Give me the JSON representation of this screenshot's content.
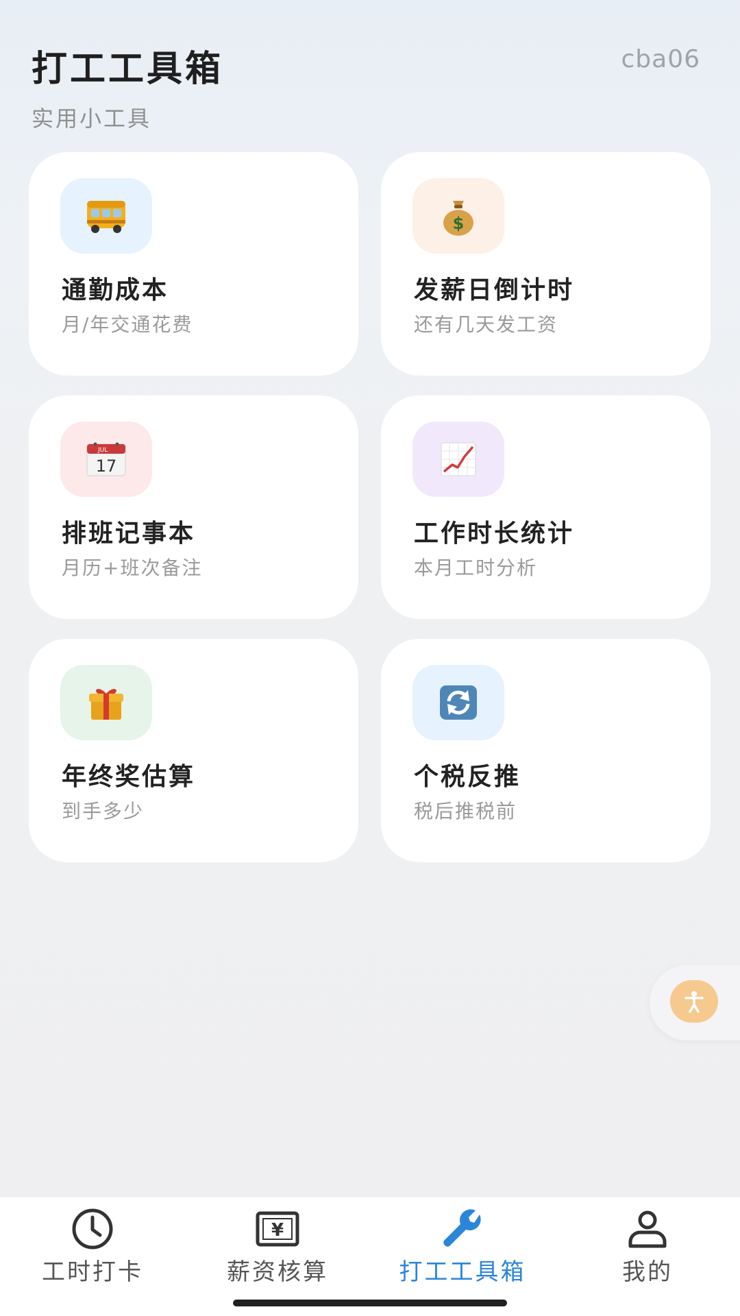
{
  "header": {
    "title": "打工工具箱",
    "subtitle": "实用小工具",
    "user_id": "cba06"
  },
  "tools": [
    {
      "name": "通勤成本",
      "desc": "月/年交通花费",
      "icon": "bus-icon",
      "icon_bg": "#e6f2fd"
    },
    {
      "name": "发薪日倒计时",
      "desc": "还有几天发工资",
      "icon": "money-bag-icon",
      "icon_bg": "#fdf0e6"
    },
    {
      "name": "排班记事本",
      "desc": "月历+班次备注",
      "icon": "calendar-icon",
      "icon_bg": "#fde9ea"
    },
    {
      "name": "工作时长统计",
      "desc": "本月工时分析",
      "icon": "chart-increasing-icon",
      "icon_bg": "#f1e9fb"
    },
    {
      "name": "年终奖估算",
      "desc": "到手多少",
      "icon": "gift-icon",
      "icon_bg": "#e6f4ea"
    },
    {
      "name": "个税反推",
      "desc": "税后推税前",
      "icon": "refresh-arrows-icon",
      "icon_bg": "#e6f2fd"
    }
  ],
  "calendar_icon": {
    "month": "JUL",
    "day": "17"
  },
  "tabbar": {
    "active_index": 2,
    "active_color": "#2b86d9",
    "items": [
      {
        "label": "工时打卡",
        "icon": "clock-icon"
      },
      {
        "label": "薪资核算",
        "icon": "yen-bill-icon"
      },
      {
        "label": "打工工具箱",
        "icon": "wrench-icon"
      },
      {
        "label": "我的",
        "icon": "user-icon"
      }
    ]
  },
  "colors": {
    "card_bg": "#ffffff",
    "page_bg": "#efeff1",
    "fab_bg": "#f6c98e"
  }
}
